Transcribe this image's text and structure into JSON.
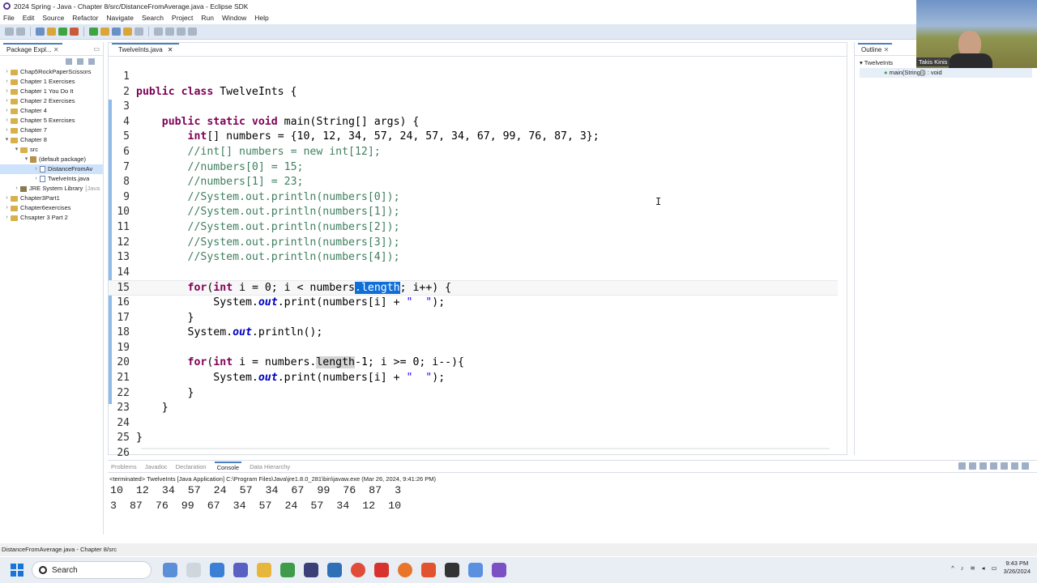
{
  "window": {
    "title": "2024 Spring - Java - Chapter 8/src/DistanceFromAverage.java - Eclipse SDK"
  },
  "menu": [
    "File",
    "Edit",
    "Source",
    "Refactor",
    "Navigate",
    "Search",
    "Project",
    "Run",
    "Window",
    "Help"
  ],
  "package_explorer": {
    "tab": "Package Expl...",
    "items": [
      {
        "label": "Chap5RockPaperScissors",
        "depth": 0,
        "type": "project"
      },
      {
        "label": "Chapter 1 Exercises",
        "depth": 0,
        "type": "project"
      },
      {
        "label": "Chapter 1 You Do It",
        "depth": 0,
        "type": "project"
      },
      {
        "label": "Chapter 2 Exercises",
        "depth": 0,
        "type": "project"
      },
      {
        "label": "Chapter 4",
        "depth": 0,
        "type": "project"
      },
      {
        "label": "Chapter 5 Exercises",
        "depth": 0,
        "type": "project"
      },
      {
        "label": "Chapter 7",
        "depth": 0,
        "type": "project"
      },
      {
        "label": "Chapter 8",
        "depth": 0,
        "type": "project",
        "open": true
      },
      {
        "label": "src",
        "depth": 1,
        "type": "folder",
        "open": true
      },
      {
        "label": "(default package)",
        "depth": 2,
        "type": "package",
        "open": true
      },
      {
        "label": "DistanceFromAv",
        "depth": 3,
        "type": "file",
        "selected": true
      },
      {
        "label": "TwelveInts.java",
        "depth": 3,
        "type": "file"
      },
      {
        "label": "JRE System Library",
        "suffix": "[Java",
        "depth": 1,
        "type": "library"
      },
      {
        "label": "Chapter3Part1",
        "depth": 0,
        "type": "project"
      },
      {
        "label": "Chapter6exercises",
        "depth": 0,
        "type": "project"
      },
      {
        "label": "Chsapter 3 Part 2",
        "depth": 0,
        "type": "project"
      }
    ]
  },
  "editor": {
    "tab": "TwelveInts.java",
    "lines": [
      {
        "n": "1",
        "parts": []
      },
      {
        "n": "2",
        "parts": [
          [
            "kw",
            "public class "
          ],
          [
            "",
            "TwelveInts {"
          ]
        ]
      },
      {
        "n": "3",
        "parts": []
      },
      {
        "n": "4",
        "parts": [
          [
            "",
            "    "
          ],
          [
            "kw",
            "public static void "
          ],
          [
            "",
            "main(String[] args) {"
          ]
        ]
      },
      {
        "n": "5",
        "parts": [
          [
            "",
            "        "
          ],
          [
            "kw",
            "int"
          ],
          [
            "",
            "[] numbers = {10, 12, 34, 57, 24, 57, 34, 67, 99, 76, 87, 3};"
          ]
        ]
      },
      {
        "n": "6",
        "parts": [
          [
            "",
            "        "
          ],
          [
            "cm",
            "//int[] numbers = new int[12];"
          ]
        ]
      },
      {
        "n": "7",
        "parts": [
          [
            "",
            "        "
          ],
          [
            "cm",
            "//numbers[0] = 15;"
          ]
        ]
      },
      {
        "n": "8",
        "parts": [
          [
            "",
            "        "
          ],
          [
            "cm",
            "//numbers[1] = 23;"
          ]
        ]
      },
      {
        "n": "9",
        "parts": [
          [
            "",
            "        "
          ],
          [
            "cm",
            "//System.out.println(numbers[0]);"
          ]
        ]
      },
      {
        "n": "10",
        "parts": [
          [
            "",
            "        "
          ],
          [
            "cm",
            "//System.out.println(numbers[1]);"
          ]
        ]
      },
      {
        "n": "11",
        "parts": [
          [
            "",
            "        "
          ],
          [
            "cm",
            "//System.out.println(numbers[2]);"
          ]
        ]
      },
      {
        "n": "12",
        "parts": [
          [
            "",
            "        "
          ],
          [
            "cm",
            "//System.out.println(numbers[3]);"
          ]
        ]
      },
      {
        "n": "13",
        "parts": [
          [
            "",
            "        "
          ],
          [
            "cm",
            "//System.out.println(numbers[4]);"
          ]
        ]
      },
      {
        "n": "14",
        "parts": []
      },
      {
        "n": "15",
        "parts": [
          [
            "",
            "        "
          ],
          [
            "kw",
            "for"
          ],
          [
            "",
            "("
          ],
          [
            "kw",
            "int"
          ],
          [
            "",
            " i = 0; i < numbers"
          ],
          [
            "hl",
            ".length"
          ],
          [
            "",
            "; i++) {"
          ]
        ],
        "current": true
      },
      {
        "n": "16",
        "parts": [
          [
            "",
            "            System."
          ],
          [
            "fl",
            "out"
          ],
          [
            "",
            ".print(numbers[i] + "
          ],
          [
            "st",
            "\"  \""
          ],
          [
            "",
            ");"
          ]
        ]
      },
      {
        "n": "17",
        "parts": [
          [
            "",
            "        }"
          ]
        ]
      },
      {
        "n": "18",
        "parts": [
          [
            "",
            "        System."
          ],
          [
            "fl",
            "out"
          ],
          [
            "",
            ".println();"
          ]
        ]
      },
      {
        "n": "19",
        "parts": []
      },
      {
        "n": "20",
        "parts": [
          [
            "",
            "        "
          ],
          [
            "kw",
            "for"
          ],
          [
            "",
            "("
          ],
          [
            "kw",
            "int"
          ],
          [
            "",
            " i = numbers."
          ],
          [
            "hl2",
            "length"
          ],
          [
            "",
            "-1; i >= 0; i--){"
          ]
        ]
      },
      {
        "n": "21",
        "parts": [
          [
            "",
            "            System."
          ],
          [
            "fl",
            "out"
          ],
          [
            "",
            ".print(numbers[i] + "
          ],
          [
            "st",
            "\"  \""
          ],
          [
            "",
            ");"
          ]
        ]
      },
      {
        "n": "22",
        "parts": [
          [
            "",
            "        }"
          ]
        ]
      },
      {
        "n": "23",
        "parts": [
          [
            "",
            "    }"
          ]
        ]
      },
      {
        "n": "24",
        "parts": []
      },
      {
        "n": "25",
        "parts": [
          [
            "",
            "}"
          ]
        ]
      },
      {
        "n": "26",
        "parts": []
      }
    ]
  },
  "outline": {
    "tab": "Outline",
    "class_name": "TwelveInts",
    "method": "main(String[]) : void"
  },
  "webcam": {
    "name": "Takis Kinis"
  },
  "console": {
    "tabs": [
      "Problems",
      "Javadoc",
      "Declaration",
      "Console",
      "Data Hierarchy"
    ],
    "active": "Console",
    "terminated": "<terminated> TwelveInts [Java Application] C:\\Program Files\\Java\\jre1.8.0_281\\bin\\javaw.exe (Mar 26, 2024, 9:41:26 PM)",
    "output": [
      "10  12  34  57  24  57  34  67  99  76  87  3",
      "3  87  76  99  67  34  57  24  57  34  12  10"
    ]
  },
  "status": {
    "text": "DistanceFromAverage.java - Chapter 8/src"
  },
  "taskbar": {
    "search": "Search",
    "time": "9:43 PM",
    "date": "3/26/2024"
  }
}
